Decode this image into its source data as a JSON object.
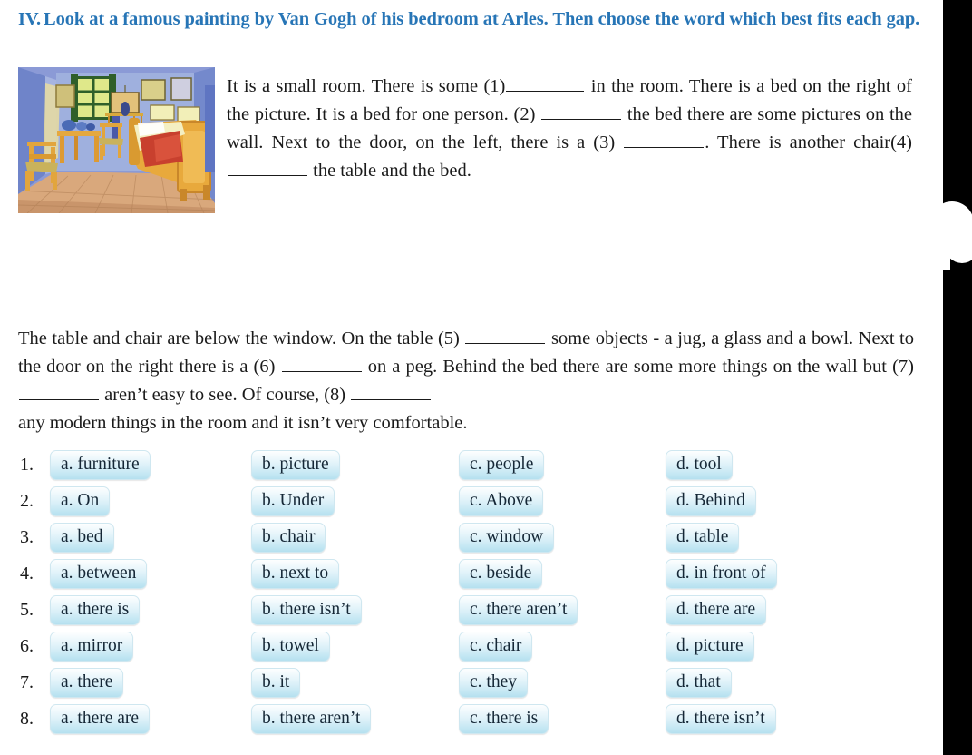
{
  "exercise": {
    "number": "IV.",
    "instruction": "Look at a famous painting by Van Gogh of his bedroom at Arles. Then choose the word which best fits each gap."
  },
  "image": {
    "caption_name": "van-gogh-bedroom-in-arles-painting"
  },
  "passage": {
    "paragraph1_part1": "It is a small room. There is some (1)",
    "paragraph1_part2": "in the room. There is a bed on the right of the picture. It is a bed for one person. (2)",
    "paragraph1_part3": "the bed there are some pictures on the wall. Next to the door, on the left, there is a (3)",
    "paragraph1_part4": ". There is another chair(4)",
    "paragraph1_part5": "the table and the bed.",
    "paragraph2_part1": "The table and chair are below the window. On the table (5)",
    "paragraph2_part2": "some objects - a jug, a glass and a bowl. Next to the door on the right there is a (6)",
    "paragraph2_part3": "on a peg. Behind the bed there are some more things on the wall but (7)",
    "paragraph2_part4": "aren’t easy to see. Of course, (8)",
    "paragraph2_part5": "any modern things in the room and it isn’t very comfortable."
  },
  "options": {
    "rows": [
      {
        "num": "1.",
        "a": "a. furniture",
        "b": "b. picture",
        "c": "c. people",
        "d": "d. tool"
      },
      {
        "num": "2.",
        "a": "a. On",
        "b": "b. Under",
        "c": "c. Above",
        "d": "d. Behind"
      },
      {
        "num": "3.",
        "a": "a. bed",
        "b": "b. chair",
        "c": "c. window",
        "d": "d. table"
      },
      {
        "num": "4.",
        "a": "a. between",
        "b": "b. next to",
        "c": "c. beside",
        "d": "d. in front of"
      },
      {
        "num": "5.",
        "a": "a. there is",
        "b": "b. there isn’t",
        "c": "c. there aren’t",
        "d": "d. there are"
      },
      {
        "num": "6.",
        "a": "a. mirror",
        "b": "b. towel",
        "c": "c. chair",
        "d": "d. picture"
      },
      {
        "num": "7.",
        "a": "a. there",
        "b": "b. it",
        "c": "c. they",
        "d": "d. that"
      },
      {
        "num": "8.",
        "a": "a. there are",
        "b": "b. there aren’t",
        "c": "c. there is",
        "d": "d. there isn’t"
      }
    ]
  },
  "colors": {
    "heading": "#2775b6",
    "body_text": "#1a1a1a",
    "option_fill_top": "#fdfefe",
    "option_fill_bottom": "#b5e0ef",
    "option_border": "#cfe7f0",
    "gutter": "#000000"
  }
}
